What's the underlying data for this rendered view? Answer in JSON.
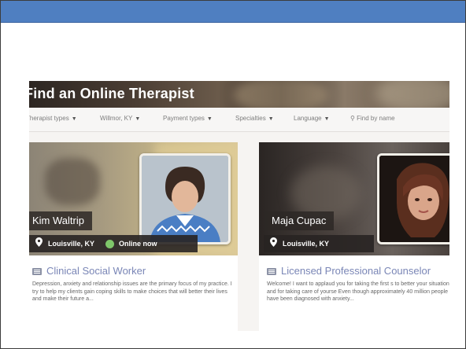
{
  "page": {
    "title": "Find an Online Therapist"
  },
  "filters": [
    {
      "label": "Therapist types"
    },
    {
      "label": "Willmor, KY"
    },
    {
      "label": "Payment types"
    },
    {
      "label": "Specialties"
    },
    {
      "label": "Language"
    },
    {
      "label": "Find by name"
    }
  ],
  "therapists": [
    {
      "name": "Kim Waltrip",
      "location": "Louisville, KY",
      "status": "Online now",
      "role": "Clinical Social Worker",
      "description": "Depression, anxiety and relationship issues are the primary focus of my practice. I try to help my clients gain coping skills to make choices that will better their lives and make their future a..."
    },
    {
      "name": "Maja Cupac",
      "location": "Louisville, KY",
      "role": "Licensed Professional Counselor",
      "description": "Welcome! I want to applaud you for taking the first s to better your situation, and for taking care of yourse Even though approximately 40 million people have been diagnosed with anxiety..."
    }
  ],
  "colors": {
    "topbar": "#4f7fc1",
    "role_text": "#7a86b6",
    "online_dot": "#7fc76a"
  },
  "icons": {
    "location": "map-pin-icon",
    "online": "online-status-icon",
    "role": "id-card-icon",
    "search": "search-icon",
    "dropdown": "caret-down-icon"
  }
}
